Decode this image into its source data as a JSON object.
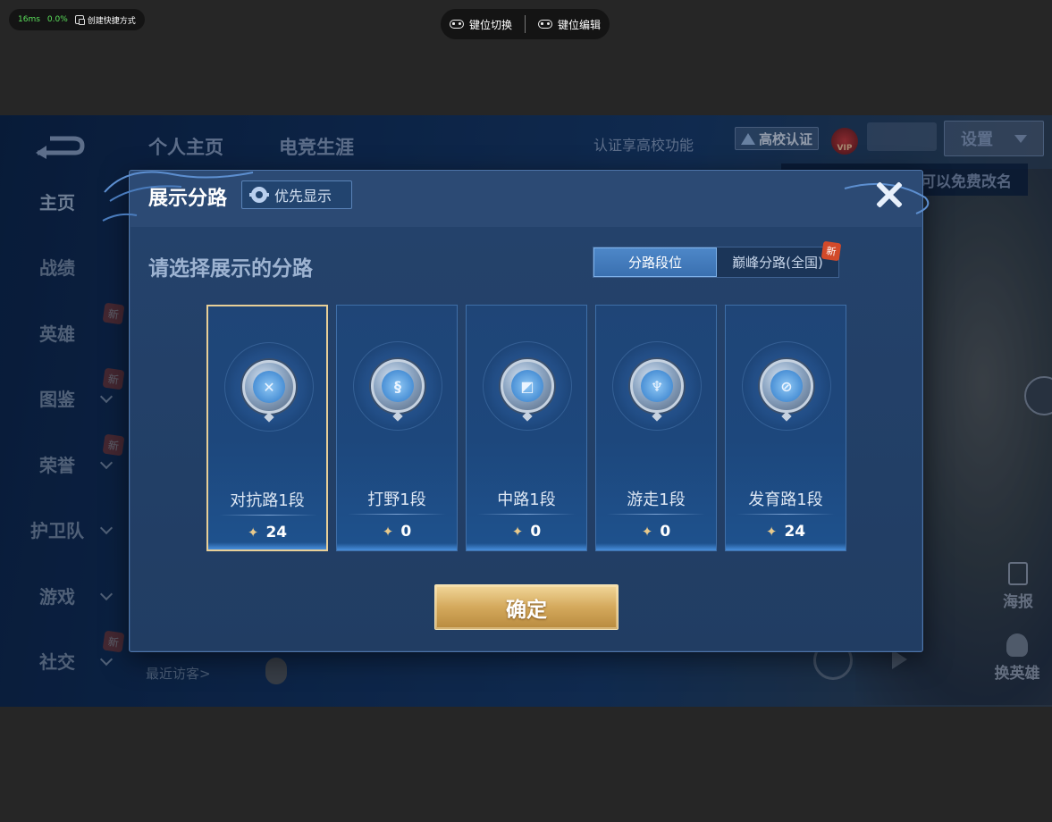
{
  "emulator": {
    "perf_ms": "16ms",
    "perf_pct": "0.0%",
    "shortcut_label": "创建快捷方式",
    "keymap_switch": "键位切换",
    "keymap_edit": "键位编辑"
  },
  "game": {
    "nav": {
      "profile_tab": "个人主页",
      "career_tab": "电竞生涯"
    },
    "auth_text": "认证享高校功能",
    "campus_badge": "高校认证",
    "vip_label": "VIP",
    "settings_label": "设置",
    "rename_tip": "可以免费改名",
    "sidebar": [
      {
        "label": "主页",
        "active": true,
        "chevron": false,
        "new": false
      },
      {
        "label": "战绩",
        "active": false,
        "chevron": false,
        "new": false
      },
      {
        "label": "英雄",
        "active": false,
        "chevron": false,
        "new": true
      },
      {
        "label": "图鉴",
        "active": false,
        "chevron": true,
        "new": true
      },
      {
        "label": "荣誉",
        "active": false,
        "chevron": true,
        "new": true
      },
      {
        "label": "护卫队",
        "active": false,
        "chevron": true,
        "new": false
      },
      {
        "label": "游戏",
        "active": false,
        "chevron": true,
        "new": false
      },
      {
        "label": "社交",
        "active": false,
        "chevron": true,
        "new": true
      }
    ],
    "new_tag": "新",
    "visitors_label": "最近访客>",
    "poster_label": "海报",
    "swap_hero_label": "换英雄"
  },
  "dialog": {
    "title": "展示分路",
    "priority_button": "优先显示",
    "prompt": "请选择展示的分路",
    "tabs": [
      {
        "label": "分路段位",
        "active": true,
        "new": false
      },
      {
        "label": "巅峰分路(全国)",
        "active": false,
        "new": true
      }
    ],
    "tab_new_tag": "新",
    "lanes": [
      {
        "name": "对抗路1段",
        "score": "24",
        "selected": true,
        "glyph": "✕"
      },
      {
        "name": "打野1段",
        "score": "0",
        "selected": false,
        "glyph": "§"
      },
      {
        "name": "中路1段",
        "score": "0",
        "selected": false,
        "glyph": "◩"
      },
      {
        "name": "游走1段",
        "score": "0",
        "selected": false,
        "glyph": "♆"
      },
      {
        "name": "发育路1段",
        "score": "24",
        "selected": false,
        "glyph": "⊘"
      }
    ],
    "confirm": "确定"
  }
}
